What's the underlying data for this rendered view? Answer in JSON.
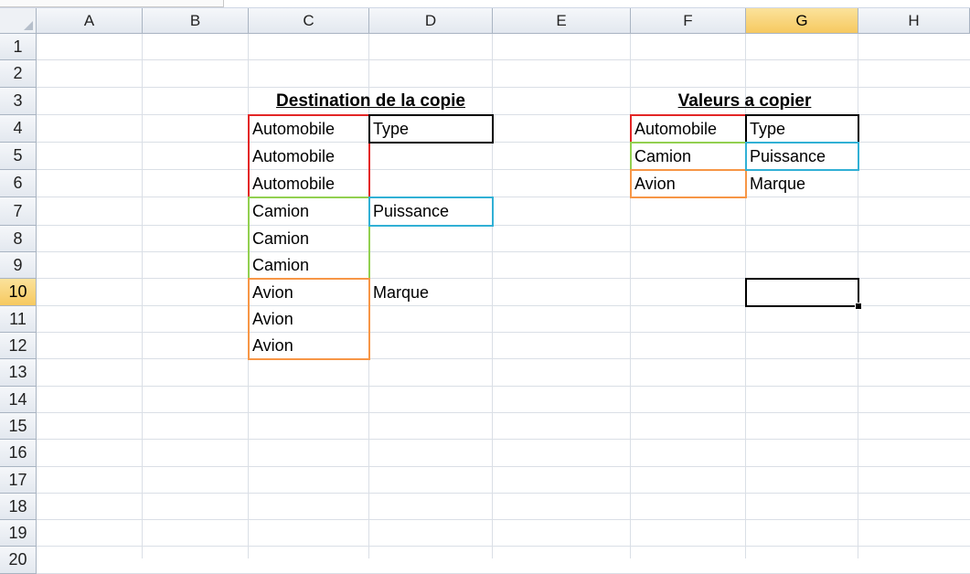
{
  "columns": [
    "A",
    "B",
    "C",
    "D",
    "E",
    "F",
    "G",
    "H"
  ],
  "rows": [
    "1",
    "2",
    "3",
    "4",
    "5",
    "6",
    "7",
    "8",
    "9",
    "10",
    "11",
    "12",
    "13",
    "14",
    "15",
    "16",
    "17",
    "18",
    "19",
    "20"
  ],
  "selected": {
    "column": "G",
    "row": "10"
  },
  "cells": {
    "C3": "Destination de la copie",
    "C4": "Automobile",
    "C5": "Automobile",
    "C6": "Automobile",
    "C7": "Camion",
    "C8": "Camion",
    "C9": "Camion",
    "C10": "Avion",
    "C11": "Avion",
    "C12": "Avion",
    "D4": "Type",
    "D7": "Puissance",
    "D10": "Marque",
    "F3": "Valeurs a copier",
    "F4": "Automobile",
    "F5": "Camion",
    "F6": "Avion",
    "G4": "Type",
    "G5": "Puissance",
    "G6": "Marque"
  },
  "colors": {
    "red": "#e32626",
    "green": "#92d050",
    "orange": "#f79646",
    "blue": "#31b0d5",
    "black": "#000000"
  }
}
